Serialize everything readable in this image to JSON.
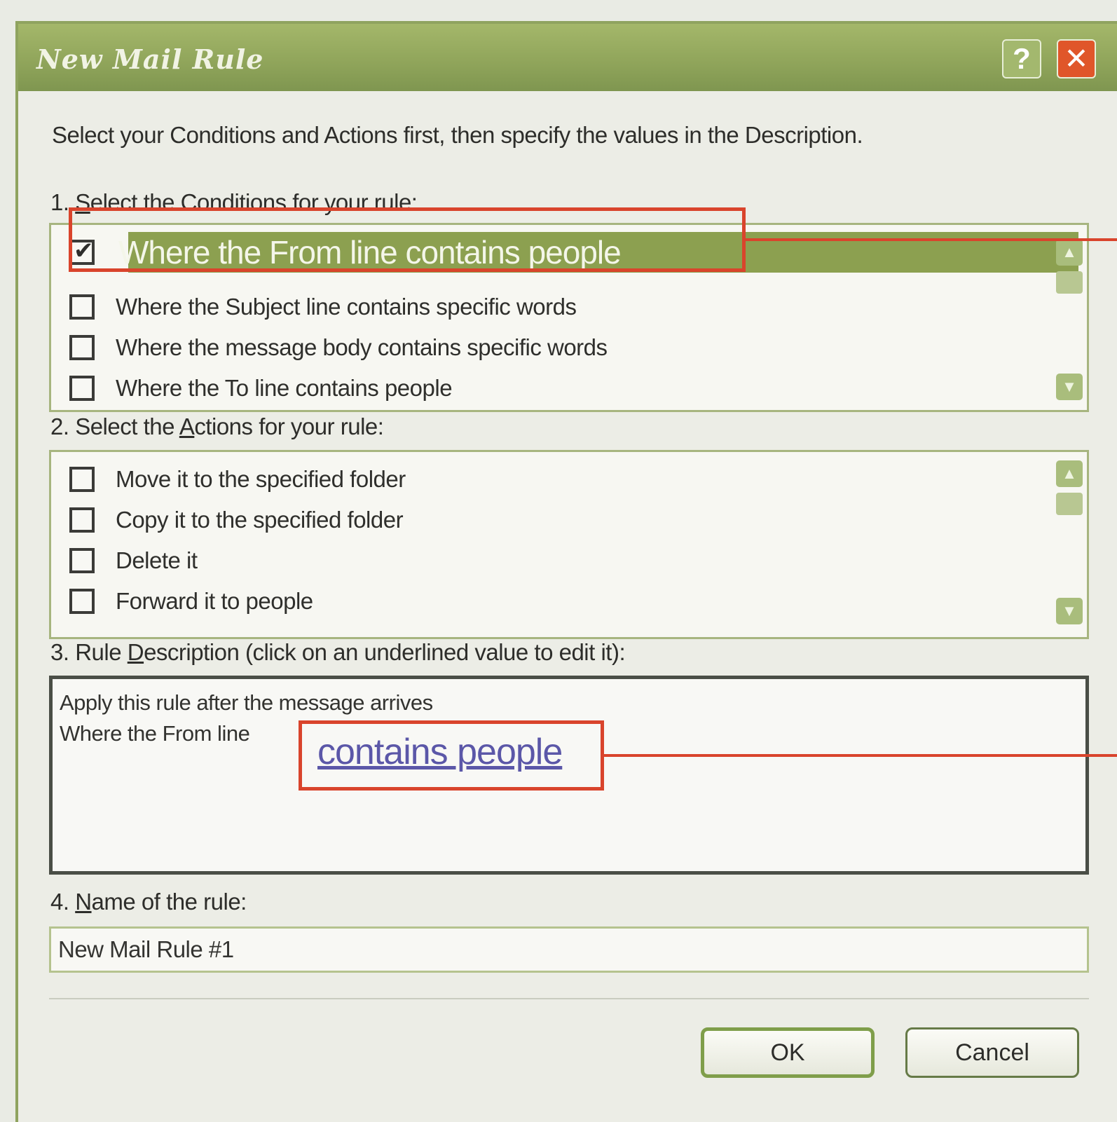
{
  "dialog": {
    "title": "New Mail Rule",
    "help_glyph": "?",
    "close_glyph": "✕"
  },
  "intro_text": "Select your Conditions and Actions first, then specify the values in the Description.",
  "conditions": {
    "label_prefix": "1. ",
    "label_access": "S",
    "label_rest": "elect the Conditions for your rule:",
    "items": [
      {
        "label": "Where the From line contains people",
        "checked": true,
        "selected": true
      },
      {
        "label": "Where the Subject line contains specific words",
        "checked": false
      },
      {
        "label": "Where the message body contains specific words",
        "checked": false
      },
      {
        "label": "Where the To line contains people",
        "checked": false
      }
    ]
  },
  "actions": {
    "label_prefix": "2. Select the ",
    "label_access": "A",
    "label_rest": "ctions for your rule:",
    "items": [
      {
        "label": "Move it to the specified folder",
        "checked": false
      },
      {
        "label": "Copy it to the specified folder",
        "checked": false
      },
      {
        "label": "Delete it",
        "checked": false
      },
      {
        "label": "Forward it to people",
        "checked": false
      }
    ]
  },
  "description": {
    "label_prefix": "3. Rule ",
    "label_access": "D",
    "label_rest": "escription (click on an underlined value to edit it):",
    "line1": "Apply this rule after the message arrives",
    "line2": "Where the From line",
    "link": "contains people"
  },
  "rule_name": {
    "label_prefix": "4. ",
    "label_access": "N",
    "label_rest": "ame of the rule:",
    "value": "New Mail Rule #1"
  },
  "buttons": {
    "ok": "OK",
    "cancel": "Cancel"
  },
  "colors": {
    "selection": "#8ca050",
    "callout": "#d9442c",
    "link": "#5b57a8"
  }
}
